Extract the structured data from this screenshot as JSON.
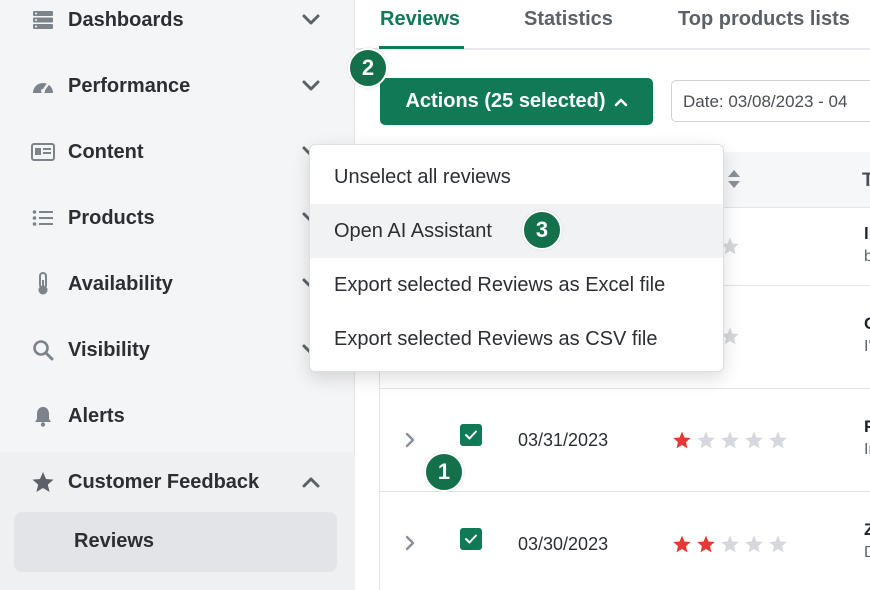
{
  "sidebar": {
    "items": [
      {
        "label": "Dashboards",
        "icon": "server-icon"
      },
      {
        "label": "Performance",
        "icon": "gauge-icon"
      },
      {
        "label": "Content",
        "icon": "id-card-icon"
      },
      {
        "label": "Products",
        "icon": "list-icon"
      },
      {
        "label": "Availability",
        "icon": "thermometer-icon"
      },
      {
        "label": "Visibility",
        "icon": "search-icon"
      },
      {
        "label": "Alerts",
        "icon": "bell-icon"
      },
      {
        "label": "Customer Feedback",
        "icon": "star-icon"
      }
    ],
    "sub_item": "Reviews"
  },
  "tabs": [
    "Reviews",
    "Statistics",
    "Top products lists"
  ],
  "actions": {
    "label": "Actions (25 selected)"
  },
  "date_filter": "Date: 03/08/2023 - 04",
  "table": {
    "header_partial": "T",
    "rows": [
      {
        "date": "",
        "rating": 1,
        "title": "li",
        "sub": "b"
      },
      {
        "date": "",
        "rating": 0,
        "title": "C",
        "sub": "I'"
      },
      {
        "date": "03/31/2023",
        "rating": 1,
        "title": "F",
        "sub": "Ir"
      },
      {
        "date": "03/30/2023",
        "rating": 2,
        "title": "Z",
        "sub": "D"
      }
    ]
  },
  "dropdown": {
    "items": [
      "Unselect all reviews",
      "Open AI Assistant",
      "Export selected Reviews as Excel file",
      "Export selected Reviews as CSV file"
    ]
  },
  "badges": [
    "1",
    "2",
    "3"
  ],
  "colors": {
    "accent": "#0f7a55",
    "star_red": "#e53935",
    "star_gold": "#c8860d",
    "star_empty": "#d5d8dc"
  }
}
